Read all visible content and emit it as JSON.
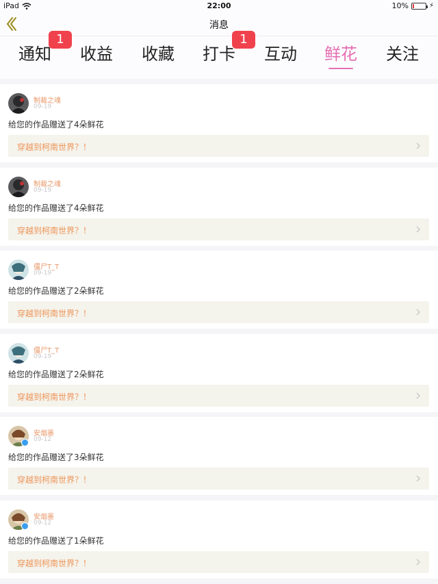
{
  "status_bar": {
    "device": "iPad",
    "time": "22:00",
    "battery": "10%",
    "battery_level": 0.1
  },
  "nav": {
    "title": "消息",
    "back_icon": "chevron-left-icon"
  },
  "tabs": [
    {
      "label": "通知",
      "badge": "1",
      "active": false
    },
    {
      "label": "收益",
      "badge": "",
      "active": false
    },
    {
      "label": "收藏",
      "badge": "",
      "active": false
    },
    {
      "label": "打卡",
      "badge": "1",
      "active": false
    },
    {
      "label": "互动",
      "badge": "",
      "active": false
    },
    {
      "label": "鲜花",
      "badge": "",
      "active": true
    },
    {
      "label": "关注",
      "badge": "",
      "active": false
    }
  ],
  "colors": {
    "accent": "#e46fb2",
    "badge": "#f0424c",
    "username": "#e9986a",
    "link": "#ee9559"
  },
  "notifications": [
    {
      "user": "制裁之魂",
      "date": "09-19",
      "message": "给您的作品赠送了4朵鲜花",
      "work": "穿越到柯南世界？！",
      "verified": false,
      "avatar": "dark"
    },
    {
      "user": "制裁之魂",
      "date": "09-19",
      "message": "给您的作品赠送了4朵鲜花",
      "work": "穿越到柯南世界？！",
      "verified": false,
      "avatar": "dark"
    },
    {
      "user": "僵尸T_T",
      "date": "09-19",
      "message": "给您的作品赠送了2朵鲜花",
      "work": "穿越到柯南世界？！",
      "verified": false,
      "avatar": "teal"
    },
    {
      "user": "僵尸T_T",
      "date": "09-19",
      "message": "给您的作品赠送了2朵鲜花",
      "work": "穿越到柯南世界？！",
      "verified": false,
      "avatar": "teal"
    },
    {
      "user": "安烟墨",
      "date": "09-12",
      "message": "给您的作品赠送了3朵鲜花",
      "work": "穿越到柯南世界？！",
      "verified": true,
      "avatar": "warm"
    },
    {
      "user": "安烟墨",
      "date": "09-12",
      "message": "给您的作品赠送了1朵鲜花",
      "work": "穿越到柯南世界？！",
      "verified": true,
      "avatar": "warm"
    }
  ]
}
